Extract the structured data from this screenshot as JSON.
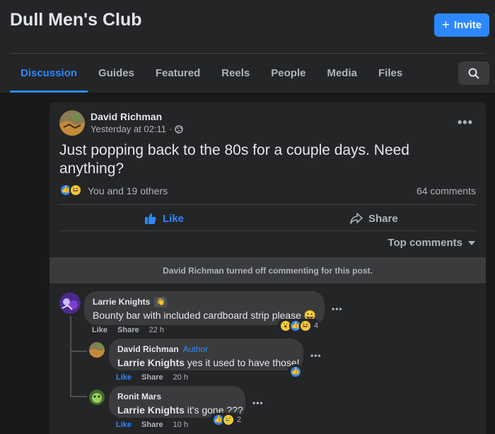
{
  "header": {
    "title": "Dull Men's Club",
    "invite_label": "Invite"
  },
  "tabs": [
    {
      "label": "Discussion",
      "active": true
    },
    {
      "label": "Guides"
    },
    {
      "label": "Featured"
    },
    {
      "label": "Reels"
    },
    {
      "label": "People"
    },
    {
      "label": "Media"
    },
    {
      "label": "Files"
    }
  ],
  "post": {
    "author": "David Richman",
    "timestamp": "Yesterday at 02:11",
    "separator": "·",
    "text": "Just popping back to the 80s for a couple days. Need anything?",
    "reactions_text": "You and 19 others",
    "comments_count": "64 comments",
    "like_label": "Like",
    "share_label": "Share",
    "sort_label": "Top comments",
    "notice": "David Richman turned off commenting for this post."
  },
  "comments": [
    {
      "author": "Larrie Knights",
      "text": "Bounty bar with included cardboard strip please 😀",
      "like_label": "Like",
      "share_label": "Share",
      "time": "22 h",
      "reaction_count": "4"
    },
    {
      "author": "David Richman",
      "badge": "Author",
      "mention": "Larrie Knights",
      "text": "yes it used to have those!",
      "like_label": "Like",
      "share_label": "Share",
      "time": "20 h"
    },
    {
      "author": "Ronit Mars",
      "mention": "Larrie Knights",
      "text": "it's gone ???",
      "like_label": "Like",
      "share_label": "Share",
      "time": "10 h",
      "reaction_count": "2"
    }
  ],
  "colors": {
    "accent": "#2d88ff",
    "background": "#18191a",
    "card": "#242526",
    "bubble": "#3a3b3c"
  },
  "icons": [
    "plus-icon",
    "search-icon",
    "globe-icon",
    "more-icon",
    "like-icon",
    "share-icon",
    "caret-down-icon",
    "wave-icon"
  ]
}
